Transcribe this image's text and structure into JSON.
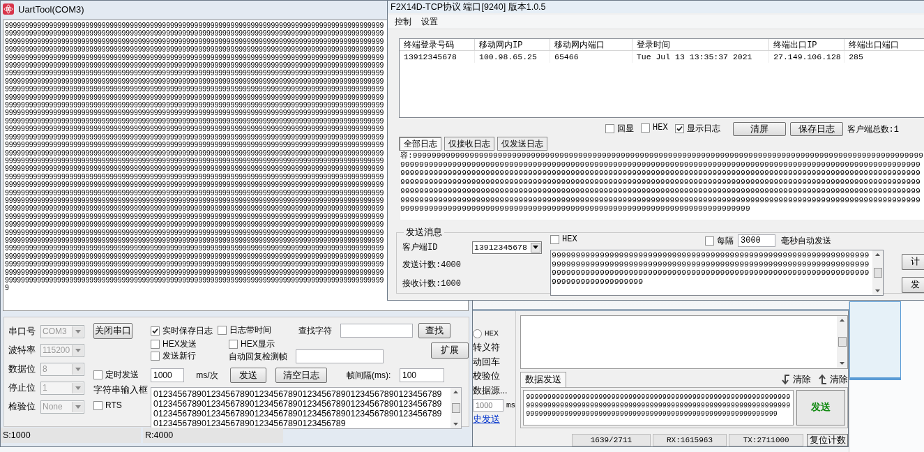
{
  "uart_window": {
    "title": "UartTool(COM3)",
    "receive_text": "9999999999999999999999999999999999999999999999999999999999999999999999999999999999999999999999999999999999999999999999999999999999999999999999999999999999999999999999999999999999999999999999999999999999999999999999999999999999999999999999999999999999999999999999999999999999999999999999999999999999999999999999999999999999999999999999999999999999999999999999999999999999999999999999999999999999999999999999999999999999999999999999999999999999999999999999999999999999999999999999999999999999999999999999999999999999999999999999999999999999999999999999999999999999999999999999999999999999999999999999999999999999999999999999999999999999999999999999999999999999999999999999999999999999999999999999999999999999999999999999999999999999999999999999999999999999999999999999999999999999999999999999999999999999999999999999999999999999999999999999999999999999999999999999999999999999999999999999999999999999999999999999999999999999999999999999999999999999999999999999999999999999999999999999999999999999999999999999999999999999999999999999999999999999999999999999999999999999999999999999999999999999999999999999999999999999999999999999999999999999999999999999999999999999999999999999999999999999999999999999999999999999999999999999999999999999999999999999999999999999999999999999999999999999999999999999999999999999999999999999999999999999999999999999999999999999999999999999999999999999999999999999999999999999999999999999999999999999999999999999999999999999999999999999999999999999999999999999999999999999999999999999999999999999999999999999999999999999999999999999999999999999999999999999999999999999999999999999999999999999999999999999999999999999999999999999999999999999999999999999999999999999999999999999999999999999999999999999999999999999999999999999999999999999999999999999999999999999999999999999999999999999999999999999999999999999999999999999999999999999999999999999999999999999999999999999999999999999999999999999999999999999999999999999999999999999999999999999999999999999999999999999999999999999999999999999999999999999999999999999999999999999999999999999999999999999999999999999999999999999999999999999999999999999999999999999999999999999999999999999999999999999999999999999999999999999999999999999999999999999999999999999999999999999999999999999999999999999999999999999999999999999999999999999999999999999999999999999999999999999999999999999999999999999999999999999999999999999999999999999999999999999999999999999999999999999999999999999999999999999999999999999999999999999999999999999999999999999999999999999999999999999999999999999999999999999999999999999999999999999999999999999999999999999999999999999999999999999999999999999999999999999999999999999999999999999999999999999999999999999999999999999999999999999999999999999999999999999999999999999999999999999999999999999999999999999999999999999999999999999999999999999999999999999999999999999999999999999999999999999999999999999999999999999999999999999999999999999999999999999999999999999999999999999999999999999999999999999999999999999999999999999999999999999999999999999999999999999999999999999999999999999999999999999999999999999999999999",
    "port_settings": [
      {
        "label": "串口号",
        "value": "COM3",
        "disabled": true
      },
      {
        "label": "波特率",
        "value": "115200",
        "disabled": true
      },
      {
        "label": "数据位",
        "value": "8",
        "disabled": true
      },
      {
        "label": "停止位",
        "value": "1",
        "disabled": true
      },
      {
        "label": "检验位",
        "value": "None",
        "disabled": true
      }
    ],
    "close_port_button": "关闭串口",
    "timed_send": {
      "label": "定时发送",
      "checked": false
    },
    "input_label": "字符串输入框",
    "rts": {
      "label": "RTS",
      "checked": false
    },
    "save_log": {
      "label": "实时保存日志",
      "checked": true
    },
    "log_time": {
      "label": "日志带时间",
      "checked": false
    },
    "hex_send": {
      "label": "HEX发送",
      "checked": false
    },
    "hex_show": {
      "label": "HEX显示",
      "checked": false
    },
    "new_line": {
      "label": "发送新行",
      "checked": false
    },
    "find_label": "查找字符",
    "find_button": "查找",
    "auto_reply_label": "自动回复检测帧",
    "extend_button": "扩展",
    "interval_value": "1000",
    "interval_unit": "ms/次",
    "send_button": "发送",
    "clear_log_button": "清空日志",
    "frame_gap_label": "帧间隔(ms):",
    "frame_gap_value": "100",
    "input_lines": [
      "012345678901234567890123456789012345678901234567890123456789",
      "012345678901234567890123456789012345678901234567890123456789",
      "012345678901234567890123456789012345678901234567890123456789",
      "0123456789012345678901234567890123456789"
    ],
    "status": [
      "S:1000",
      "R:4000"
    ]
  },
  "tcp_window": {
    "title": "F2X14D-TCP协议  端口[9240] 版本1.0.5",
    "menu": [
      "控制",
      "设置"
    ],
    "table": {
      "columns": [
        "终端登录号码",
        "移动网内IP",
        "移动网内端口",
        "登录时间",
        "终端出口IP",
        "终端出口端口"
      ],
      "rows": [
        [
          "13912345678",
          "100.98.65.25",
          "65466",
          "Tue Jul 13 13:35:37 2021",
          "27.149.106.128",
          "285"
        ]
      ]
    },
    "log_options": [
      {
        "label": "回显",
        "checked": false
      },
      {
        "label": "HEX",
        "checked": false
      },
      {
        "label": "显示日志",
        "checked": true
      }
    ],
    "clear_button": "清屏",
    "save_log_button": "保存日志",
    "client_total": "客户端总数:1",
    "log_tabs": [
      {
        "label": "全部日志",
        "selected": true
      },
      {
        "label": "仅接收日志",
        "selected": false
      },
      {
        "label": "仅发送日志",
        "selected": false
      }
    ],
    "log_text": "容:999999999999999999999999999999999999999999999999999999999999999999999999999999999999999999999999999999999999999999999999999999999999999999999999999999999999999999999999999999999999999999999999999999999999999999999999999999999999999999999999999999999999999999999999999999999999999999999999999999999999999999999999999999999999999999999999999999999999999999999999999999999999999999999999999999999999999999999999999999999999999999999999999999999999999999999999999999999999999999999999999999999999999999999999999999999999999999999999999999999999999999999999999999999999999999999999999999999999999999999999999999999999999999999999999999999999999999999999999999999999999999999999999999999999999999999999999999999999999999999999999999999999",
    "send_group": {
      "title": "发送消息",
      "client_id_label": "客户端ID",
      "client_id": "13912345678",
      "send_count": "发送计数:4000",
      "receive_count": "接收计数:1000",
      "hex": {
        "label": "HEX",
        "checked": false
      },
      "auto": {
        "label": "每隔",
        "checked": false
      },
      "auto_interval": "3000",
      "auto_unit": "毫秒自动发送",
      "message": "9999999999999999999999999999999999999999999999999999999999999999999999999999999999999999999999999999999999999999999999999999999999999999999999999999999999999999999999999999999999999999999999999999999999999999999999999",
      "side_buttons": [
        "计",
        "发"
      ]
    }
  },
  "back_window": {
    "hex_radio": {
      "label": "HEX",
      "selected": false
    },
    "option_labels": [
      "转义符",
      "动回车",
      "校验位",
      "数据源..."
    ],
    "interval_value": "1000",
    "interval_unit": "ms",
    "history_link": "史发送",
    "send_tab": {
      "label": "数据发送",
      "selected": true
    },
    "clear_actions": [
      "清除",
      "清除"
    ],
    "send_text": "999999999999999999999999999999999999999999999999999999999999999999999999999999999999999999999999999999999999999999999999999999999999999999999999999999999999999999999999999999999999999",
    "send_button": "发送",
    "status": [
      "1639/2711",
      "RX:1615963",
      "TX:2711000"
    ],
    "reset_button": "复位计数"
  }
}
